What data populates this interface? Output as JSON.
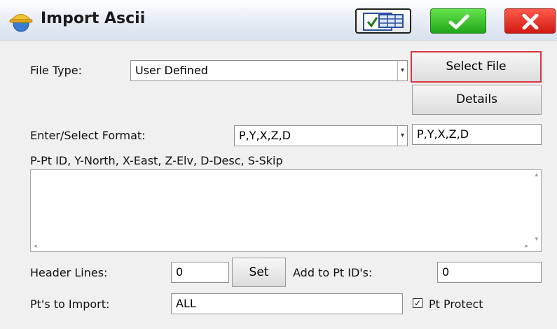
{
  "window": {
    "title": "Import Ascii"
  },
  "icons": {
    "app_icon": "globe-with-hardhat-icon",
    "table_button": "table-checkbox-icon",
    "ok_button": "checkmark-icon",
    "close_button": "close-x-icon"
  },
  "colors": {
    "ok_green": "#2fb526",
    "close_red": "#e0251c",
    "select_border": "#d9363e"
  },
  "form": {
    "file_type": {
      "label": "File Type:",
      "value": "User Defined"
    },
    "select_file_label": "Select File",
    "details_label": "Details",
    "format": {
      "label": "Enter/Select Format:",
      "dropdown_value": "P,Y,X,Z,D",
      "text_value": "P,Y,X,Z,D"
    },
    "legend": "P-Pt ID, Y-North, X-East, Z-Elv, D-Desc, S-Skip",
    "preview_text": "",
    "header_lines": {
      "label": "Header Lines:",
      "value": "0"
    },
    "set_label": "Set",
    "add_to_pt_ids": {
      "label": "Add to Pt ID's:",
      "value": "0"
    },
    "pts_to_import": {
      "label": "Pt's to Import:",
      "value": "ALL"
    },
    "pt_protect": {
      "label": "Pt Protect",
      "checked": true,
      "mark": "✓"
    }
  }
}
